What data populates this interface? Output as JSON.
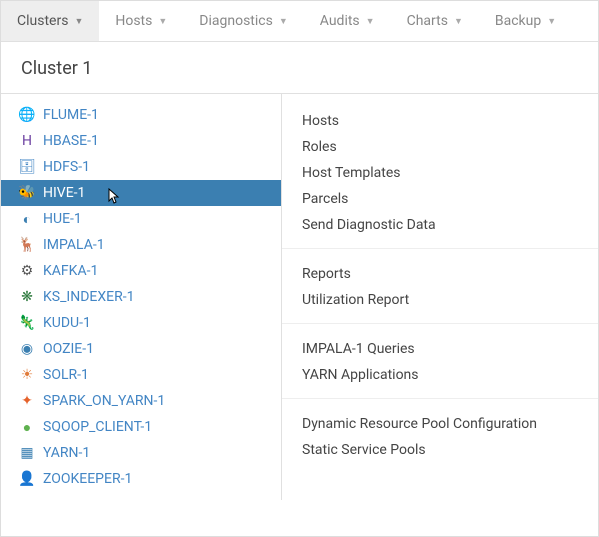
{
  "nav": {
    "items": [
      {
        "label": "Clusters",
        "active": true
      },
      {
        "label": "Hosts"
      },
      {
        "label": "Diagnostics"
      },
      {
        "label": "Audits"
      },
      {
        "label": "Charts"
      },
      {
        "label": "Backup"
      }
    ]
  },
  "cluster_title": "Cluster 1",
  "services": [
    {
      "name": "FLUME-1",
      "icon": "🌐",
      "color": ""
    },
    {
      "name": "HBASE-1",
      "icon": "H",
      "color": "#6b3fa0"
    },
    {
      "name": "HDFS-1",
      "icon": "🗄",
      "color": ""
    },
    {
      "name": "HIVE-1",
      "icon": "🐝",
      "color": "",
      "selected": true
    },
    {
      "name": "HUE-1",
      "icon": "◐",
      "color": "#3b7fb1"
    },
    {
      "name": "IMPALA-1",
      "icon": "🦌",
      "color": "#6fb9d6"
    },
    {
      "name": "KAFKA-1",
      "icon": "⚙",
      "color": "#555"
    },
    {
      "name": "KS_INDEXER-1",
      "icon": "❋",
      "color": "#2d7a3d"
    },
    {
      "name": "KUDU-1",
      "icon": "🦎",
      "color": "#4aa8d6"
    },
    {
      "name": "OOZIE-1",
      "icon": "◉",
      "color": "#3b7fb1"
    },
    {
      "name": "SOLR-1",
      "icon": "☀",
      "color": "#e07b3a"
    },
    {
      "name": "SPARK_ON_YARN-1",
      "icon": "✦",
      "color": "#e5622b"
    },
    {
      "name": "SQOOP_CLIENT-1",
      "icon": "●",
      "color": "#5fb14f"
    },
    {
      "name": "YARN-1",
      "icon": "▦",
      "color": "#3b7fb1"
    },
    {
      "name": "ZOOKEEPER-1",
      "icon": "👤",
      "color": "#7a8a3d"
    }
  ],
  "menu": {
    "groups": [
      {
        "items": [
          "Hosts",
          "Roles",
          "Host Templates",
          "Parcels",
          "Send Diagnostic Data"
        ]
      },
      {
        "items": [
          "Reports",
          "Utilization Report"
        ]
      },
      {
        "items": [
          "IMPALA-1 Queries",
          "YARN Applications"
        ]
      },
      {
        "items": [
          "Dynamic Resource Pool Configuration",
          "Static Service Pools"
        ]
      }
    ]
  }
}
